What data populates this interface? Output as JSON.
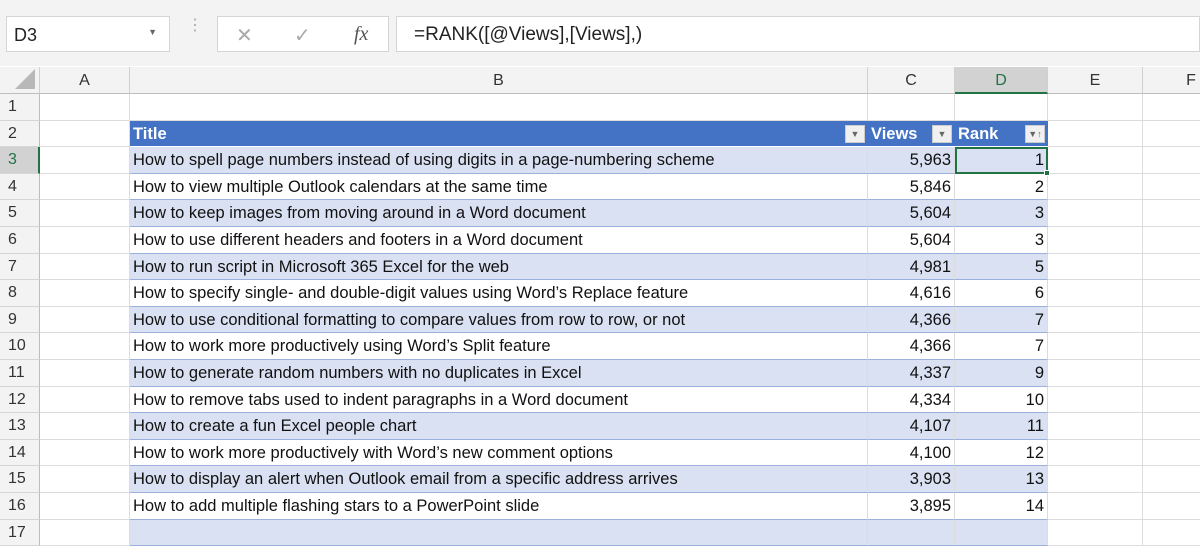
{
  "formula_bar": {
    "name_box": "D3",
    "cancel_icon": "✕",
    "enter_icon": "✓",
    "fx_label": "fx",
    "formula": "=RANK([@Views],[Views],)"
  },
  "columns": [
    "A",
    "B",
    "C",
    "D",
    "E",
    "F"
  ],
  "row_numbers": [
    "1",
    "2",
    "3",
    "4",
    "5",
    "6",
    "7",
    "8",
    "9",
    "10",
    "11",
    "12",
    "13",
    "14",
    "15",
    "16",
    "17"
  ],
  "table": {
    "headers": [
      "Title",
      "Views",
      "Rank"
    ],
    "rows": [
      [
        "How to spell page numbers instead of using digits in a page-numbering scheme",
        "5,963",
        "1"
      ],
      [
        "How to view multiple Outlook calendars at the same time",
        "5,846",
        "2"
      ],
      [
        "How to keep images from moving around in a Word document",
        "5,604",
        "3"
      ],
      [
        "How to use different headers and footers in a Word document",
        "5,604",
        "3"
      ],
      [
        "How to run script in Microsoft 365 Excel for the web",
        "4,981",
        "5"
      ],
      [
        "How to specify single- and double-digit values using Word’s Replace feature",
        "4,616",
        "6"
      ],
      [
        "How to use conditional formatting to compare values from row to row, or not",
        "4,366",
        "7"
      ],
      [
        "How to work more productively using Word’s Split feature",
        "4,366",
        "7"
      ],
      [
        "How to generate random numbers with no duplicates in Excel",
        "4,337",
        "9"
      ],
      [
        "How to remove tabs used to indent paragraphs in a Word document",
        "4,334",
        "10"
      ],
      [
        "How to create a fun Excel people chart",
        "4,107",
        "11"
      ],
      [
        "How to work more productively with Word’s new comment options",
        "4,100",
        "12"
      ],
      [
        "How to display an alert when Outlook email from a specific address arrives",
        "3,903",
        "13"
      ],
      [
        "How to add multiple flashing stars to a PowerPoint slide",
        "3,895",
        "14"
      ]
    ]
  },
  "colors": {
    "header": "#4472c4",
    "band": "#d9e1f2",
    "select": "#217346"
  }
}
